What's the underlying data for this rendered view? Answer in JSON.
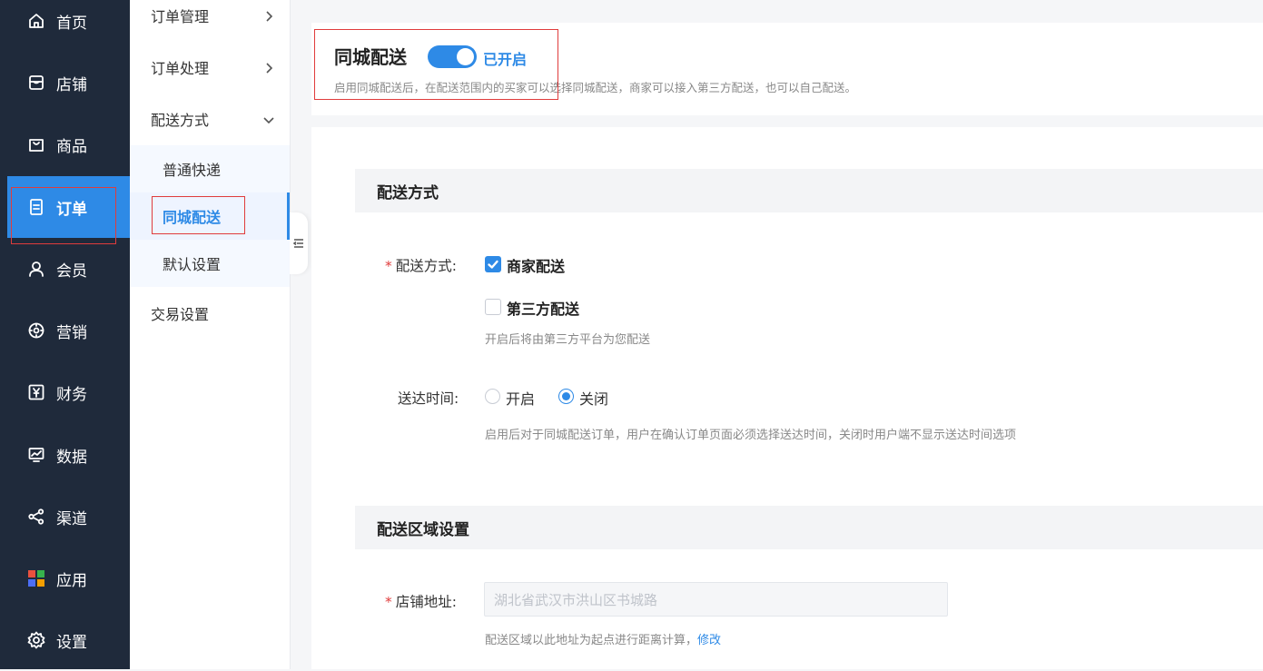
{
  "nav_primary": [
    {
      "label": "首页",
      "icon": "home-icon"
    },
    {
      "label": "店铺",
      "icon": "store-icon"
    },
    {
      "label": "商品",
      "icon": "bag-icon"
    },
    {
      "label": "订单",
      "icon": "order-icon",
      "active": true
    },
    {
      "label": "会员",
      "icon": "user-icon"
    },
    {
      "label": "营销",
      "icon": "gear-badge-icon"
    },
    {
      "label": "财务",
      "icon": "yen-icon"
    },
    {
      "label": "数据",
      "icon": "chart-icon"
    },
    {
      "label": "渠道",
      "icon": "share-icon"
    },
    {
      "label": "应用",
      "icon": "apps-grid-icon"
    },
    {
      "label": "设置",
      "icon": "settings-icon"
    }
  ],
  "nav_secondary": {
    "order_manage": "订单管理",
    "order_process": "订单处理",
    "delivery_method": "配送方式",
    "sub_express": "普通快递",
    "sub_city": "同城配送",
    "sub_default": "默认设置",
    "trade_settings": "交易设置"
  },
  "top_card": {
    "title": "同城配送",
    "switch_state": "已开启",
    "description": "启用同城配送后，在配送范围内的买家可以选择同城配送，商家可以接入第三方配送，也可以自己配送。"
  },
  "section_delivery": {
    "title": "配送方式",
    "method_label": "配送方式:",
    "option_merchant": "商家配送",
    "option_third_party": "第三方配送",
    "third_party_hint": "开启后将由第三方平台为您配送",
    "time_label": "送达时间:",
    "time_on": "开启",
    "time_off": "关闭",
    "time_hint": "启用后对于同城配送订单，用户在确认订单页面必须选择送达时间，关闭时用户端不显示送达时间选项"
  },
  "section_area": {
    "title": "配送区域设置",
    "address_label": "店铺地址:",
    "address_value": "湖北省武汉市洪山区书城路",
    "address_hint": "配送区域以此地址为起点进行距离计算，",
    "modify_link": "修改"
  },
  "colors": {
    "accent": "#2e8ae6",
    "sidebar_bg": "#1f2a3b",
    "highlight_box": "#e03c3c"
  }
}
